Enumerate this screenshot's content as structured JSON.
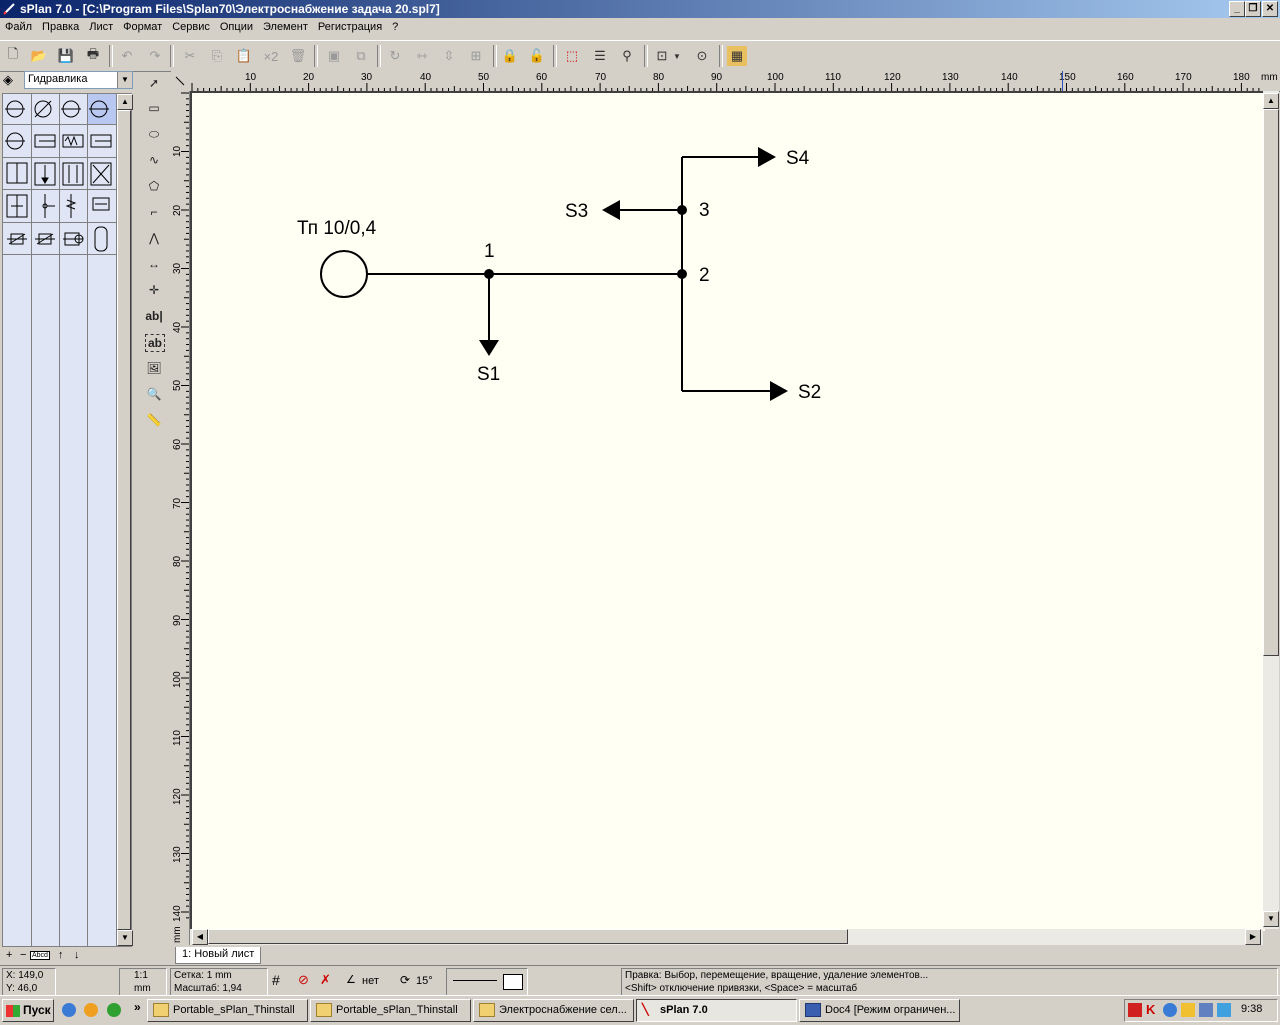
{
  "window": {
    "title": "sPlan 7.0 - [C:\\Program Files\\Splan70\\Электроснабжение задача 20.spl7]",
    "buttons": [
      "_",
      "❐",
      "✕"
    ]
  },
  "menu": [
    "Файл",
    "Правка",
    "Лист",
    "Формат",
    "Сервис",
    "Опции",
    "Элемент",
    "Регистрация",
    "?"
  ],
  "toolbar": {
    "copy_x2_label": "×2",
    "icons": [
      "new-file-icon",
      "open-folder-icon",
      "save-icon",
      "print-icon",
      "undo-icon",
      "redo-icon",
      "cut-icon",
      "copy-icon",
      "paste-icon",
      "duplicate-icon",
      "delete-icon",
      "group-icon",
      "ungroup-icon",
      "rotate-icon",
      "mirror-h-icon",
      "mirror-v-icon",
      "align-icon",
      "lock-icon",
      "unlock-icon",
      "page-layout-icon",
      "parts-list-icon",
      "find-icon",
      "grid-icon",
      "zoom-icon",
      "color-palette-icon"
    ]
  },
  "library": {
    "selected": "Гидравлика",
    "bottom_controls": [
      "+",
      "−",
      "Abcd",
      "↑",
      "↓"
    ]
  },
  "ruler": {
    "h_ticks": [
      "10",
      "20",
      "30",
      "40",
      "50",
      "60",
      "70",
      "80",
      "90",
      "100",
      "110",
      "120",
      "130",
      "140",
      "150",
      "160",
      "170",
      "180",
      "mm"
    ],
    "v_ticks": [
      "10",
      "20",
      "30",
      "40",
      "50",
      "60",
      "70",
      "80",
      "90",
      "100",
      "110",
      "120",
      "130",
      "140",
      "mm"
    ]
  },
  "drawtools": {
    "text_tool_label": "ab|",
    "text_frame_tool_label": "ab"
  },
  "diagram": {
    "source_label": "Тп 10/0,4",
    "nodes": [
      "1",
      "2",
      "3"
    ],
    "loads": [
      "S1",
      "S2",
      "S3",
      "S4"
    ]
  },
  "sheet_tab": "1: Новый лист",
  "status": {
    "coord_x": "X: 149,0",
    "coord_y": "Y: 46,0",
    "scale_ratio": "1:1",
    "unit": "mm",
    "grid": "Сетка: 1 mm",
    "zoom": "Масштаб:   1,94",
    "snap_label": "нет",
    "angle": "15°",
    "hint_line1": "Правка: Выбор, перемещение, вращение, удаление элементов...",
    "hint_line2": "<Shift> отключение привязки, <Space> = масштаб"
  },
  "taskbar": {
    "start": "Пуск",
    "more": "»",
    "tasks": [
      "Portable_sPlan_Thinstall",
      "Portable_sPlan_Thinstall",
      "Электроснабжение сел...",
      "sPlan 7.0",
      "Doc4 [Режим ограничен..."
    ],
    "clock": "9:38"
  }
}
